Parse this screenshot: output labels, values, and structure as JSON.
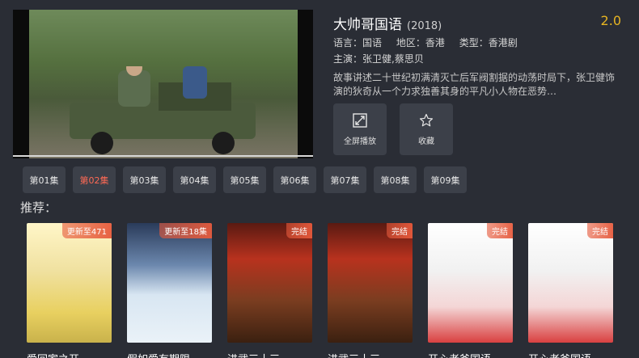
{
  "detail": {
    "title": "大帅哥国语",
    "year": "(2018)",
    "score": "2.0",
    "language": "语言：国语",
    "region": "地区：香港",
    "category": "类型：香港剧",
    "cast": "主演：张卫健,蔡思贝",
    "description": "故事讲述二十世纪初满清灭亡后军阀割据的动荡时局下，张卫健饰演的狄奇从一个力求独善其身的平凡小人物在恶势…"
  },
  "actions": {
    "fullscreen_label": "全屏播放",
    "fullscreen_icon": "expand-icon",
    "favorite_label": "收藏",
    "favorite_icon": "star-icon"
  },
  "episodes": [
    "第01集",
    "第02集",
    "第03集",
    "第04集",
    "第05集",
    "第06集",
    "第07集",
    "第08集",
    "第09集"
  ],
  "active_episode": "第02集",
  "recommend": {
    "label": "推荐：",
    "items": [
      {
        "title": "爱回家之开",
        "badge": "更新至471"
      },
      {
        "title": "假如爱有期限",
        "badge": "更新至18集"
      },
      {
        "title": "进武三十三",
        "badge": "完结"
      },
      {
        "title": "进武三十三",
        "badge": "完结"
      },
      {
        "title": "开心老爸国语",
        "badge": "完结"
      },
      {
        "title": "开心老爸国语",
        "badge": "完结"
      }
    ]
  },
  "colors": {
    "background": "#2a2d35",
    "score": "#e6b422",
    "active_episode": "#ff6a55",
    "badge": "#e65a3c"
  }
}
